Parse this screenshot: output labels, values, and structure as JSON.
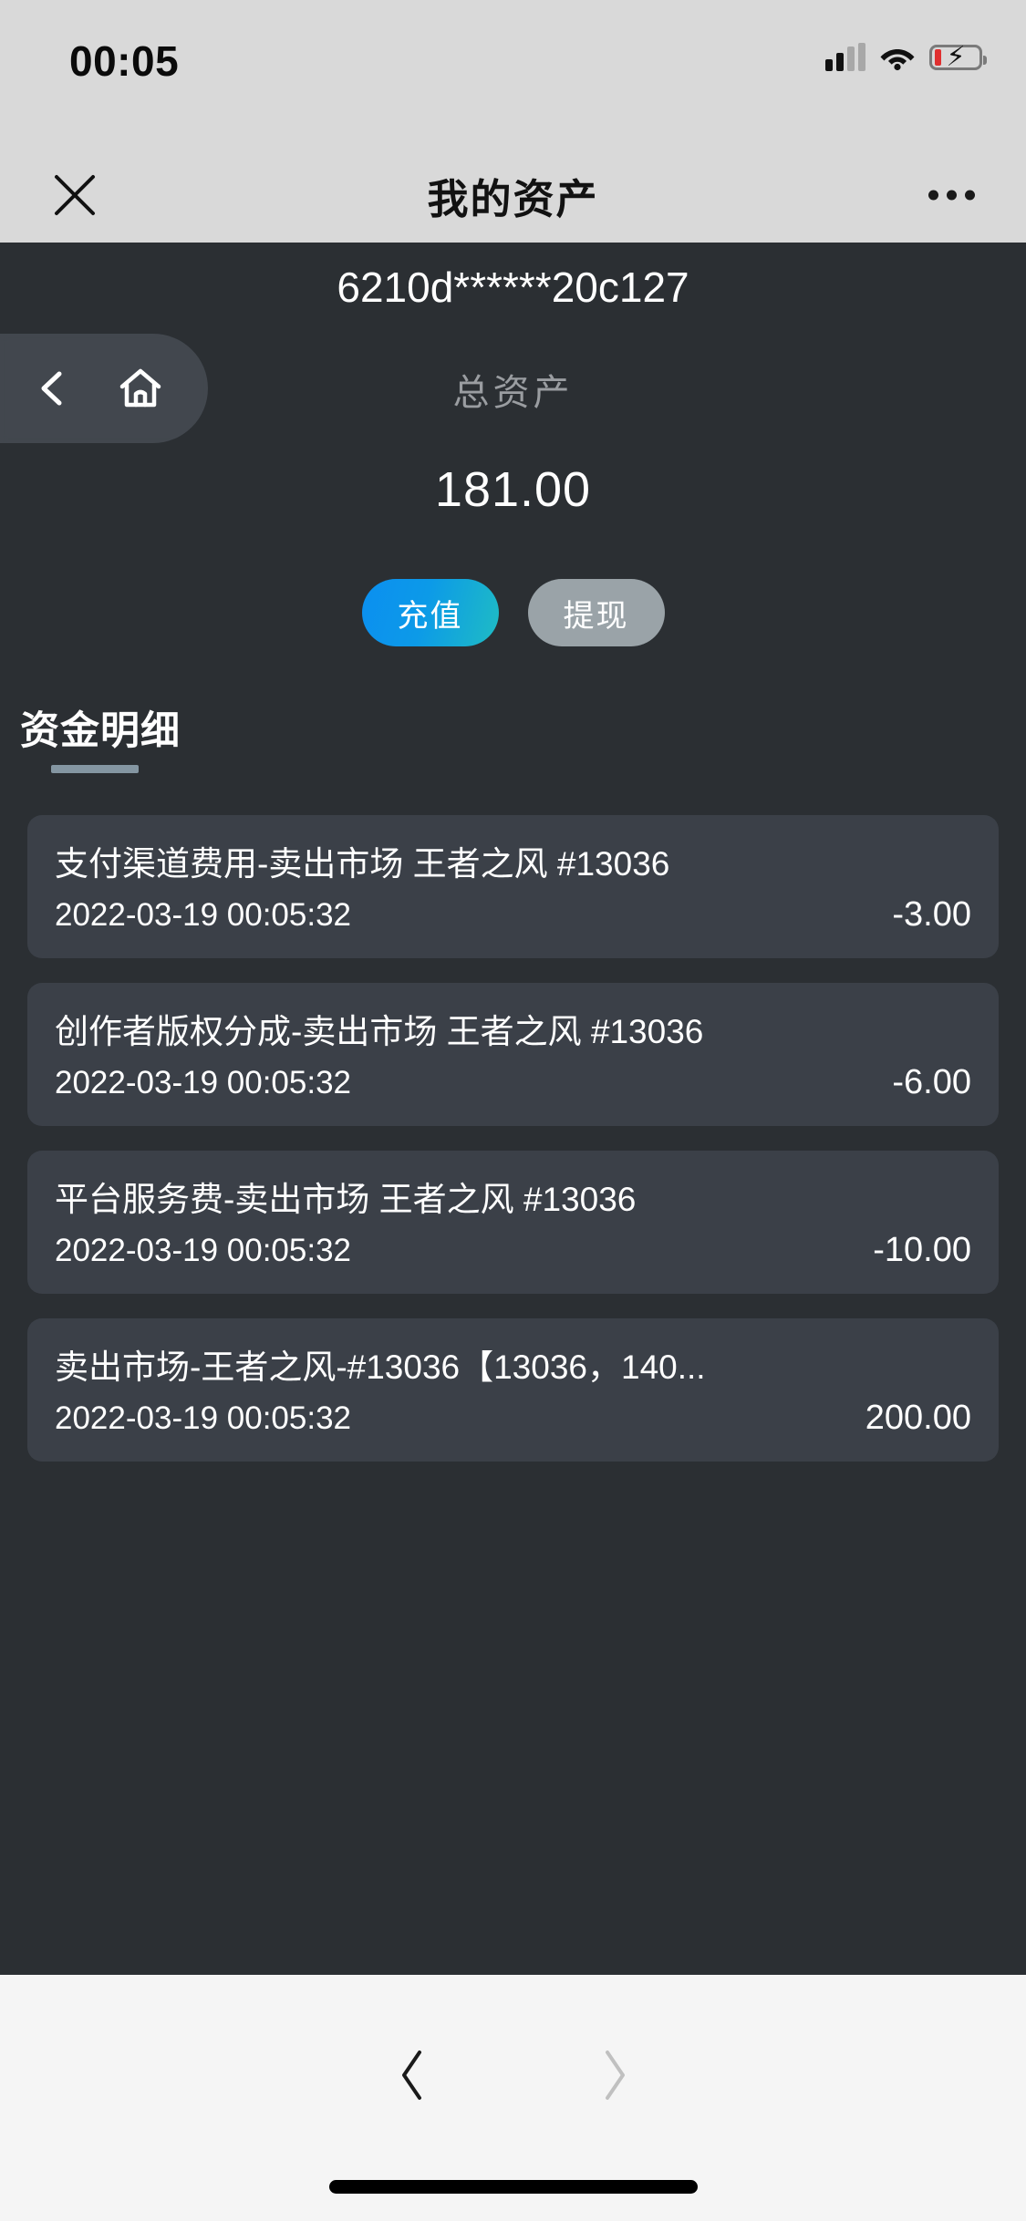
{
  "status_bar": {
    "time": "00:05",
    "icons": [
      "cellular-signal-icon",
      "wifi-icon",
      "battery-charging-icon"
    ]
  },
  "nav_bar": {
    "close_icon": "close-icon",
    "title": "我的资产",
    "more_icon": "more-options-icon"
  },
  "float_overlay": {
    "back_icon": "chevron-left-icon",
    "home_icon": "home-icon"
  },
  "wallet": {
    "address": "6210d******20c127",
    "total_label": "总资产",
    "total_amount": "181.00",
    "recharge_label": "充值",
    "withdraw_label": "提现",
    "recharge_color": "#0b8ff0",
    "recharge_color_end": "#1fbcc4",
    "withdraw_color": "#9aa3a8"
  },
  "section": {
    "title": "资金明细",
    "underline_color": "#8496a2"
  },
  "transactions": [
    {
      "title": "支付渠道费用-卖出市场 王者之风 #13036",
      "date": "2022-03-19 00:05:32",
      "amount": "-3.00"
    },
    {
      "title": "创作者版权分成-卖出市场 王者之风 #13036",
      "date": "2022-03-19 00:05:32",
      "amount": "-6.00"
    },
    {
      "title": "平台服务费-卖出市场 王者之风 #13036",
      "date": "2022-03-19 00:05:32",
      "amount": "-10.00"
    },
    {
      "title": "卖出市场-王者之风-#13036【13036，140...",
      "date": "2022-03-19 00:05:32",
      "amount": "200.00"
    }
  ],
  "bottom_bar": {
    "back_icon": "chevron-left-icon",
    "forward_icon": "chevron-right-icon",
    "back_enabled": true,
    "forward_enabled": false
  }
}
